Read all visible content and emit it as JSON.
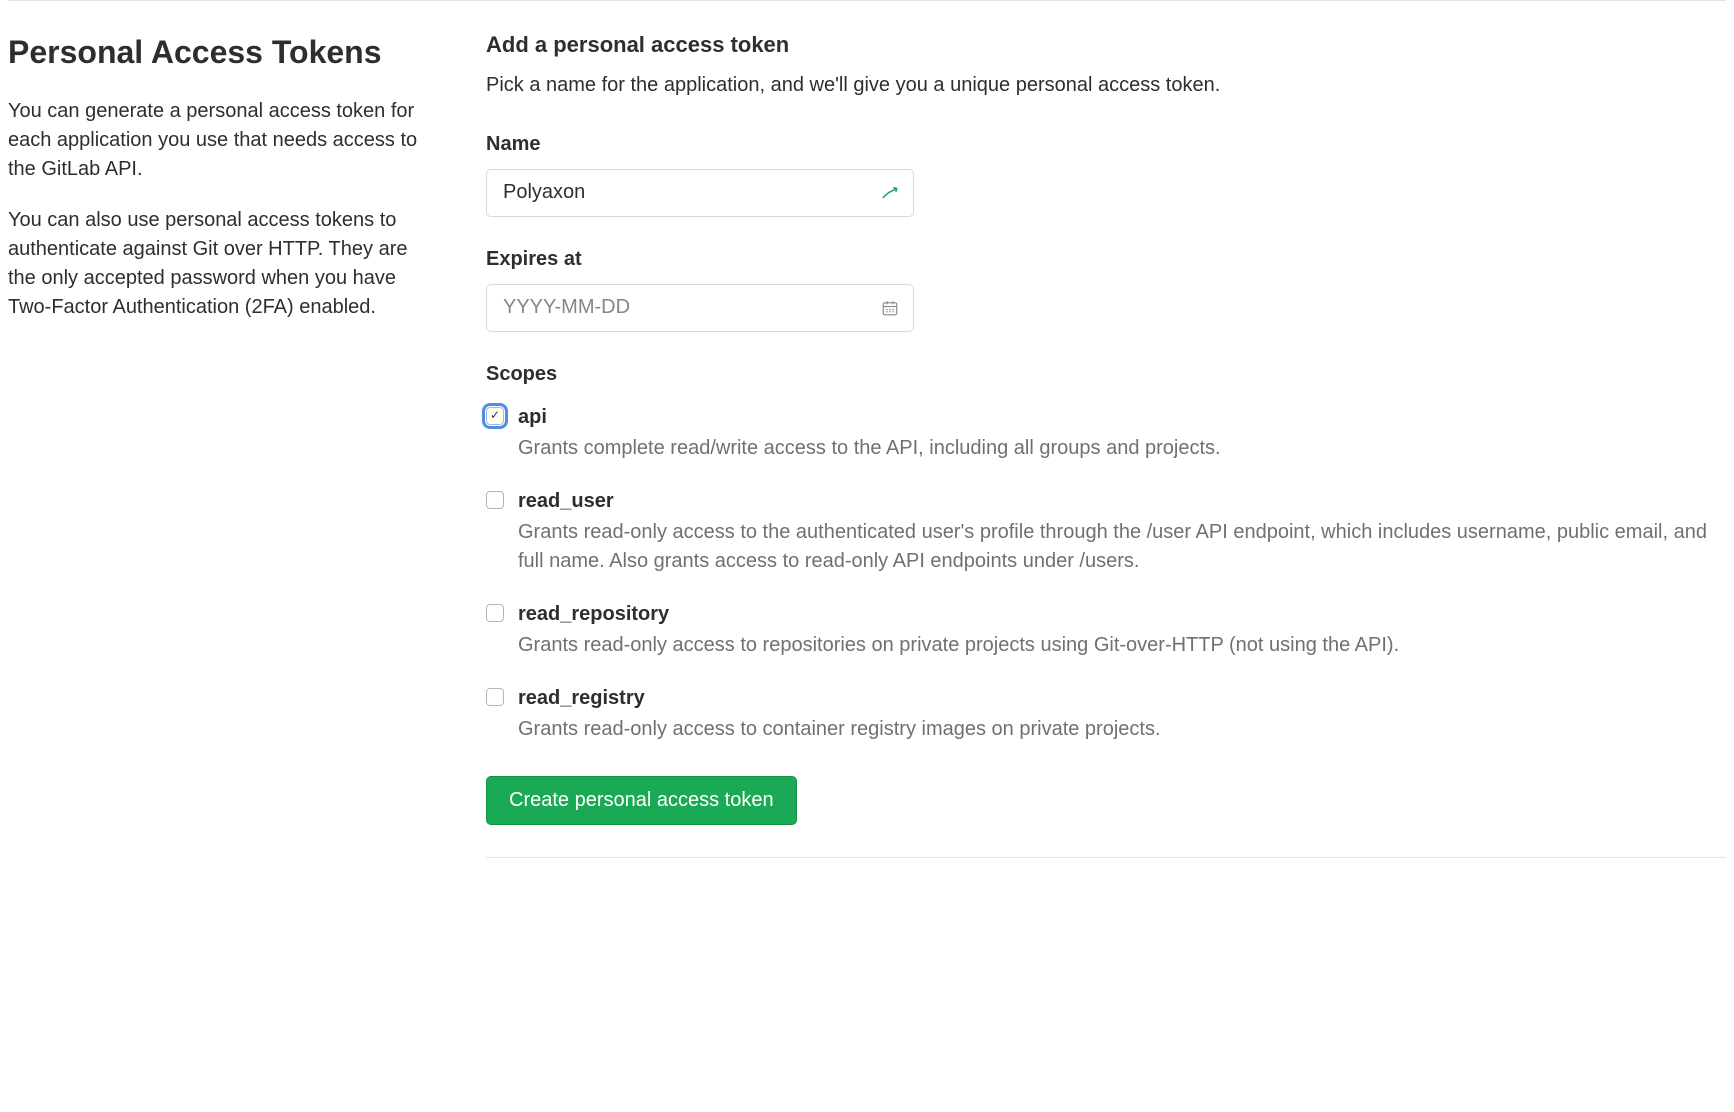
{
  "sidebar": {
    "title": "Personal Access Tokens",
    "para1": "You can generate a personal access token for each application you use that needs access to the GitLab API.",
    "para2": "You can also use personal access tokens to authenticate against Git over HTTP. They are the only accepted password when you have Two-Factor Authentication (2FA) enabled."
  },
  "form": {
    "heading": "Add a personal access token",
    "subheading": "Pick a name for the application, and we'll give you a unique personal access token.",
    "name_label": "Name",
    "name_value": "Polyaxon",
    "expires_label": "Expires at",
    "expires_placeholder": "YYYY-MM-DD",
    "expires_value": "",
    "scopes_label": "Scopes",
    "submit_label": "Create personal access token"
  },
  "scopes": [
    {
      "key": "api",
      "name": "api",
      "desc": "Grants complete read/write access to the API, including all groups and projects.",
      "checked": true,
      "focused": true
    },
    {
      "key": "read_user",
      "name": "read_user",
      "desc": "Grants read-only access to the authenticated user's profile through the /user API endpoint, which includes username, public email, and full name. Also grants access to read-only API endpoints under /users.",
      "checked": false,
      "focused": false
    },
    {
      "key": "read_repository",
      "name": "read_repository",
      "desc": "Grants read-only access to repositories on private projects using Git-over-HTTP (not using the API).",
      "checked": false,
      "focused": false
    },
    {
      "key": "read_registry",
      "name": "read_registry",
      "desc": "Grants read-only access to container registry images on private projects.",
      "checked": false,
      "focused": false
    }
  ],
  "colors": {
    "accent_green": "#1aaa55",
    "muted_text": "#707070"
  }
}
